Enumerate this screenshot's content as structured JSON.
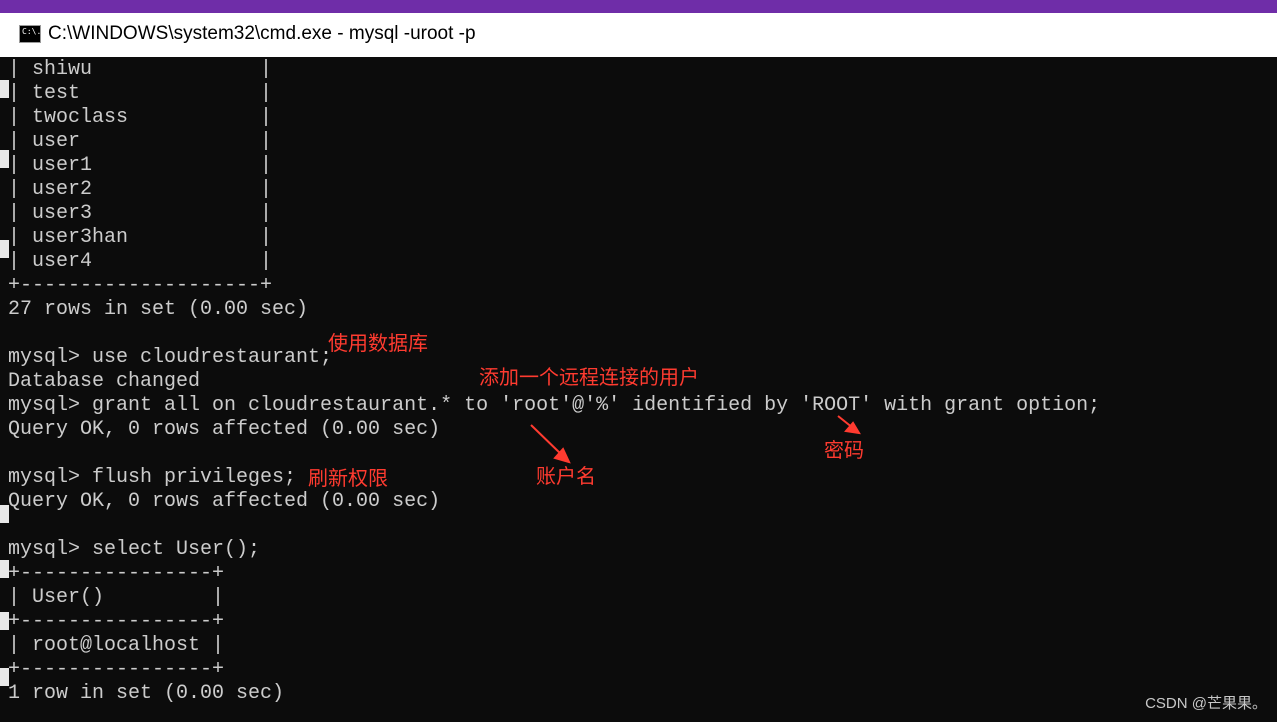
{
  "window": {
    "title": "C:\\WINDOWS\\system32\\cmd.exe - mysql  -uroot -p",
    "icon_label": "C:\\."
  },
  "console": {
    "lines": [
      "| shiwu              |",
      "| test               |",
      "| twoclass           |",
      "| user               |",
      "| user1              |",
      "| user2              |",
      "| user3              |",
      "| user3han           |",
      "| user4              |",
      "+--------------------+",
      "27 rows in set (0.00 sec)",
      "",
      "mysql> use cloudrestaurant;",
      "Database changed",
      "mysql> grant all on cloudrestaurant.* to 'root'@'%' identified by 'ROOT' with grant option;",
      "Query OK, 0 rows affected (0.00 sec)",
      "",
      "mysql> flush privileges;",
      "Query OK, 0 rows affected (0.00 sec)",
      "",
      "mysql> select User();",
      "+----------------+",
      "| User()         |",
      "+----------------+",
      "| root@localhost |",
      "+----------------+",
      "1 row in set (0.00 sec)"
    ]
  },
  "annotations": {
    "use_db": "使用数据库",
    "add_remote_user": "添加一个远程连接的用户",
    "account_name": "账户名",
    "password": "密码",
    "flush": "刷新权限",
    "color": "#ff3b30"
  },
  "watermark": "CSDN @芒果果。"
}
